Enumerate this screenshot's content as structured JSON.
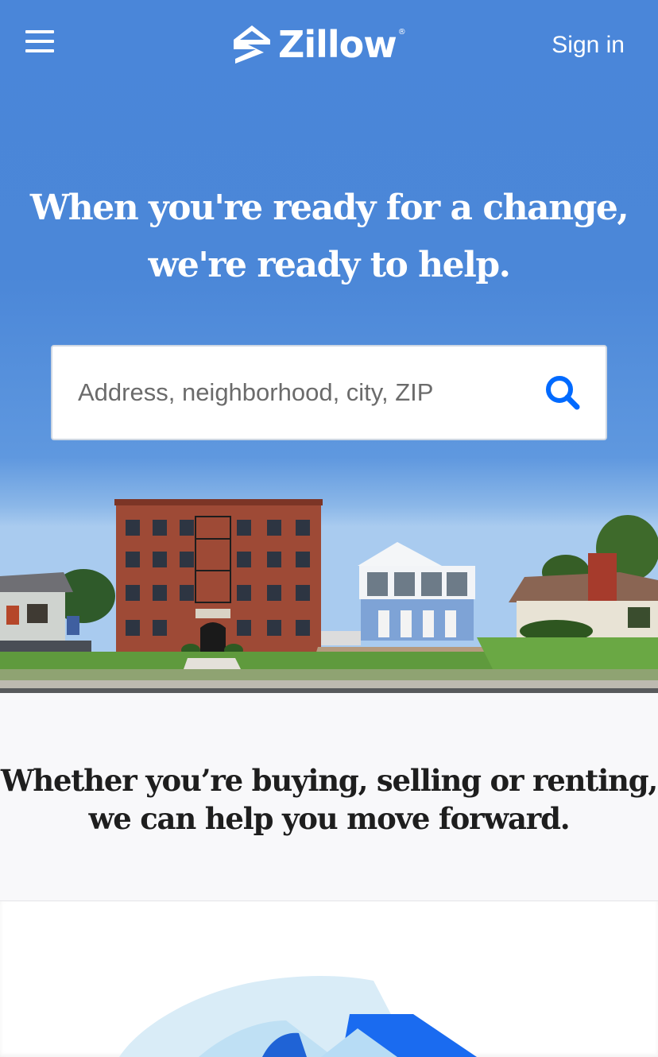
{
  "header": {
    "logo_text": "Zillow",
    "logo_reg": "®",
    "signin_label": "Sign in",
    "menu_icon": "hamburger-menu-icon"
  },
  "hero": {
    "headline_line1": "When you're ready for a change,",
    "headline_line2": "we're ready to help.",
    "search_placeholder": "Address, neighborhood, city, ZIP",
    "search_icon": "search-icon"
  },
  "section2": {
    "line1": "Whether you’re buying, selling or renting,",
    "line2": "we can help you move forward."
  },
  "colors": {
    "sky": "#4a86d9",
    "brand_blue": "#006aff",
    "subhead_text": "#1e1e1e",
    "section_bg": "#f8f8fa"
  }
}
